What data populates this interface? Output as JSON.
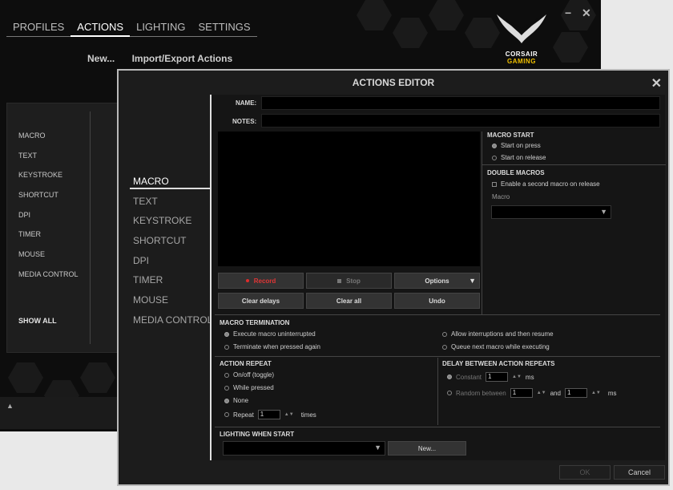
{
  "main": {
    "tabs": [
      "PROFILES",
      "ACTIONS",
      "LIGHTING",
      "SETTINGS"
    ],
    "active_tab": "ACTIONS",
    "sub_actions": [
      "New...",
      "Import/Export Actions"
    ],
    "window_controls": {
      "minimize": "−",
      "close": "✕"
    },
    "logo": {
      "line1": "CORSAIR",
      "line2": "GAMING"
    },
    "left_panel_items": [
      "MACRO",
      "TEXT",
      "KEYSTROKE",
      "SHORTCUT",
      "DPI",
      "TIMER",
      "MOUSE",
      "MEDIA CONTROL"
    ],
    "show_all": "SHOW ALL",
    "bottom_arrow": "▲"
  },
  "dialog": {
    "title": "ACTIONS EDITOR",
    "close": "✕",
    "side_items": [
      "MACRO",
      "TEXT",
      "KEYSTROKE",
      "SHORTCUT",
      "DPI",
      "TIMER",
      "MOUSE",
      "MEDIA CONTROL"
    ],
    "active_side": "MACRO",
    "name_label": "NAME:",
    "notes_label": "NOTES:",
    "buttons": {
      "record": "Record",
      "stop": "Stop",
      "options": "Options",
      "clear_delays": "Clear delays",
      "clear_all": "Clear all",
      "undo": "Undo"
    },
    "macro_start": {
      "title": "MACRO START",
      "options": [
        "Start on press",
        "Start on release"
      ],
      "selected": 0
    },
    "double_macros": {
      "title": "DOUBLE MACROS",
      "checkbox": "Enable a second macro on release",
      "macro_label": "Macro"
    },
    "termination": {
      "title": "MACRO TERMINATION",
      "options": [
        "Execute macro uninterrupted",
        "Terminate when pressed again",
        "Allow interruptions and then resume",
        "Queue next macro while executing"
      ],
      "selected": 0
    },
    "repeat": {
      "title": "ACTION REPEAT",
      "options": [
        "On/off (toggle)",
        "While pressed",
        "None",
        "Repeat"
      ],
      "selected": 2,
      "repeat_value": "1",
      "times": "times"
    },
    "delay": {
      "title": "DELAY BETWEEN ACTION REPEATS",
      "constant": "Constant",
      "constant_value": "1",
      "ms": "ms",
      "random": "Random between",
      "random_from": "1",
      "and": "and",
      "random_to": "1"
    },
    "lighting": {
      "title": "LIGHTING WHEN START",
      "new_button": "New..."
    },
    "ok": "OK",
    "cancel": "Cancel"
  }
}
